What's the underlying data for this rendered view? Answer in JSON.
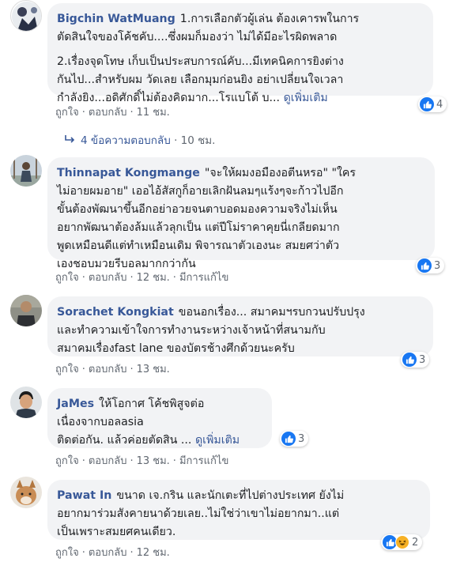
{
  "comments": [
    {
      "name": "Bigchin WatMuang",
      "lines": [
        "1.การเลือกตัวผู้เล่น ต้องเคารพในการ",
        "ตัดสินใจของโค้ชคับ....ซึ่งผมก็มองว่า ไม่ได้มีอะไรผิดพลาด",
        "",
        "2.เรื่องจุดโทษ เก็บเป็นประสบการณ์คับ...มีเทคนิคการยิงต่าง",
        "กันไป...สำหรับผม วัดเลย เลือกมุมก่อนยิง อย่าเปลี่ยนใจเวลา",
        "กำลังยิง...อดิศักดิ์ไม่ต้องคิดมาก...โรแบโต้ บ..."
      ],
      "more": "ดูเพิ่มเติม",
      "like": "ถูกใจ",
      "reply": "ตอบกลับ",
      "time": "11 ชม.",
      "edited": "",
      "reactions": "4",
      "reply_count": "4 ข้อความตอบกลับ",
      "reply_time": "10 ชม."
    },
    {
      "name": "Thinnapat Kongmange",
      "lines": [
        "\"จะให้ผมงอมืองอตีนหรอ\" \"ใคร",
        "ไม่อายผมอาย\" เออไอ้สัสกูก็อายเลิกฝันลมๆแร้งๆจะก้าวไปอีก",
        "ขั้นต้องพัฒนาขึ้นอีกอย่าอวยจนตาบอดมองความจริงไม่เห็น",
        "อยากพัฒนาต้องล้มแล้วลุกเป็น แต่ปีโม่ราคาคุยนี่เกลียดมาก",
        "พูดเหมือนดีแต่ทำเหมือนเดิม พิจารณาตัวเองนะ สมยศว่าตัว",
        "เองชอบมวยรีบอลมากกว่ากัน"
      ],
      "more": "",
      "like": "ถูกใจ",
      "reply": "ตอบกลับ",
      "time": "12 ชม.",
      "edited": "มีการแก้ไข",
      "reactions": "3"
    },
    {
      "name": "Sorachet Kongkiat",
      "lines": [
        "ขอนอกเรื่อง... สมาคมฯรบกวนปรับปรุง",
        "และทำความเข้าใจการทำงานระหว่างเจ้าหน้าที่สนามกับ",
        "สมาคมเรื่องfast lane ของบัตรช้างศึกด้วยนะครับ"
      ],
      "more": "",
      "like": "ถูกใจ",
      "reply": "ตอบกลับ",
      "time": "13 ชม.",
      "edited": "",
      "reactions": "3"
    },
    {
      "name": "JaMes",
      "lines": [
        "ให้โอกาศ โค้ชพิสูจต่อ",
        "เนื่องจากบอลasia",
        "ติดต่อกัน. แล้วค่อยตัดสิน ..."
      ],
      "more": "ดูเพิ่มเติม",
      "like": "ถูกใจ",
      "reply": "ตอบกลับ",
      "time": "13 ชม.",
      "edited": "มีการแก้ไข",
      "reactions": "3"
    },
    {
      "name": "Pawat In",
      "lines": [
        "ขนาด เจ.กริน และนักเตะที่ไปต่างประเทศ ยังไม่",
        "อยากมาร่วมสังคายนาด้วยเลย..ไม่ใช่ว่าเขาไม่อยากมา..แต่",
        "เป็นเพราะสมยศคนเดียว."
      ],
      "more": "",
      "like": "ถูกใจ",
      "reply": "ตอบกลับ",
      "time": "12 ชม.",
      "edited": "",
      "reactions": "2"
    }
  ],
  "colors": {
    "name": "#385898",
    "bubble": "#f2f3f5",
    "meta": "#606770",
    "like": "#1877f2",
    "haha": "#f7b125"
  },
  "icons": [
    "like-icon",
    "haha-icon",
    "reply-arrow-icon"
  ]
}
